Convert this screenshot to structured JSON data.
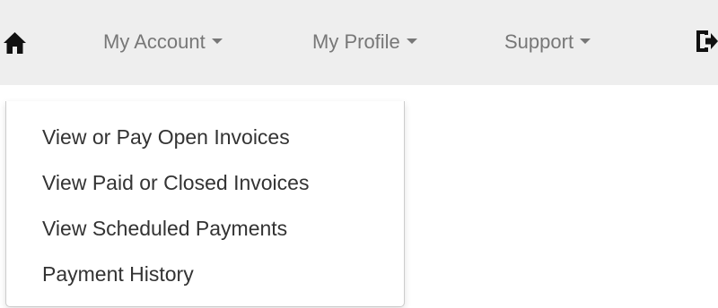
{
  "navbar": {
    "home_icon": "home-icon",
    "items": [
      {
        "label": "My Account"
      },
      {
        "label": "My Profile"
      },
      {
        "label": "Support"
      }
    ],
    "logout_icon": "logout-icon"
  },
  "dropdown": {
    "items": [
      {
        "label": "View or Pay Open Invoices"
      },
      {
        "label": "View Paid or Closed Invoices"
      },
      {
        "label": "View Scheduled Payments"
      },
      {
        "label": "Payment History"
      }
    ]
  },
  "colors": {
    "navbar_bg": "#eeeeee",
    "nav_text": "#777777",
    "icon": "#111111",
    "dropdown_text": "#333333",
    "dropdown_border": "#cccccc"
  }
}
